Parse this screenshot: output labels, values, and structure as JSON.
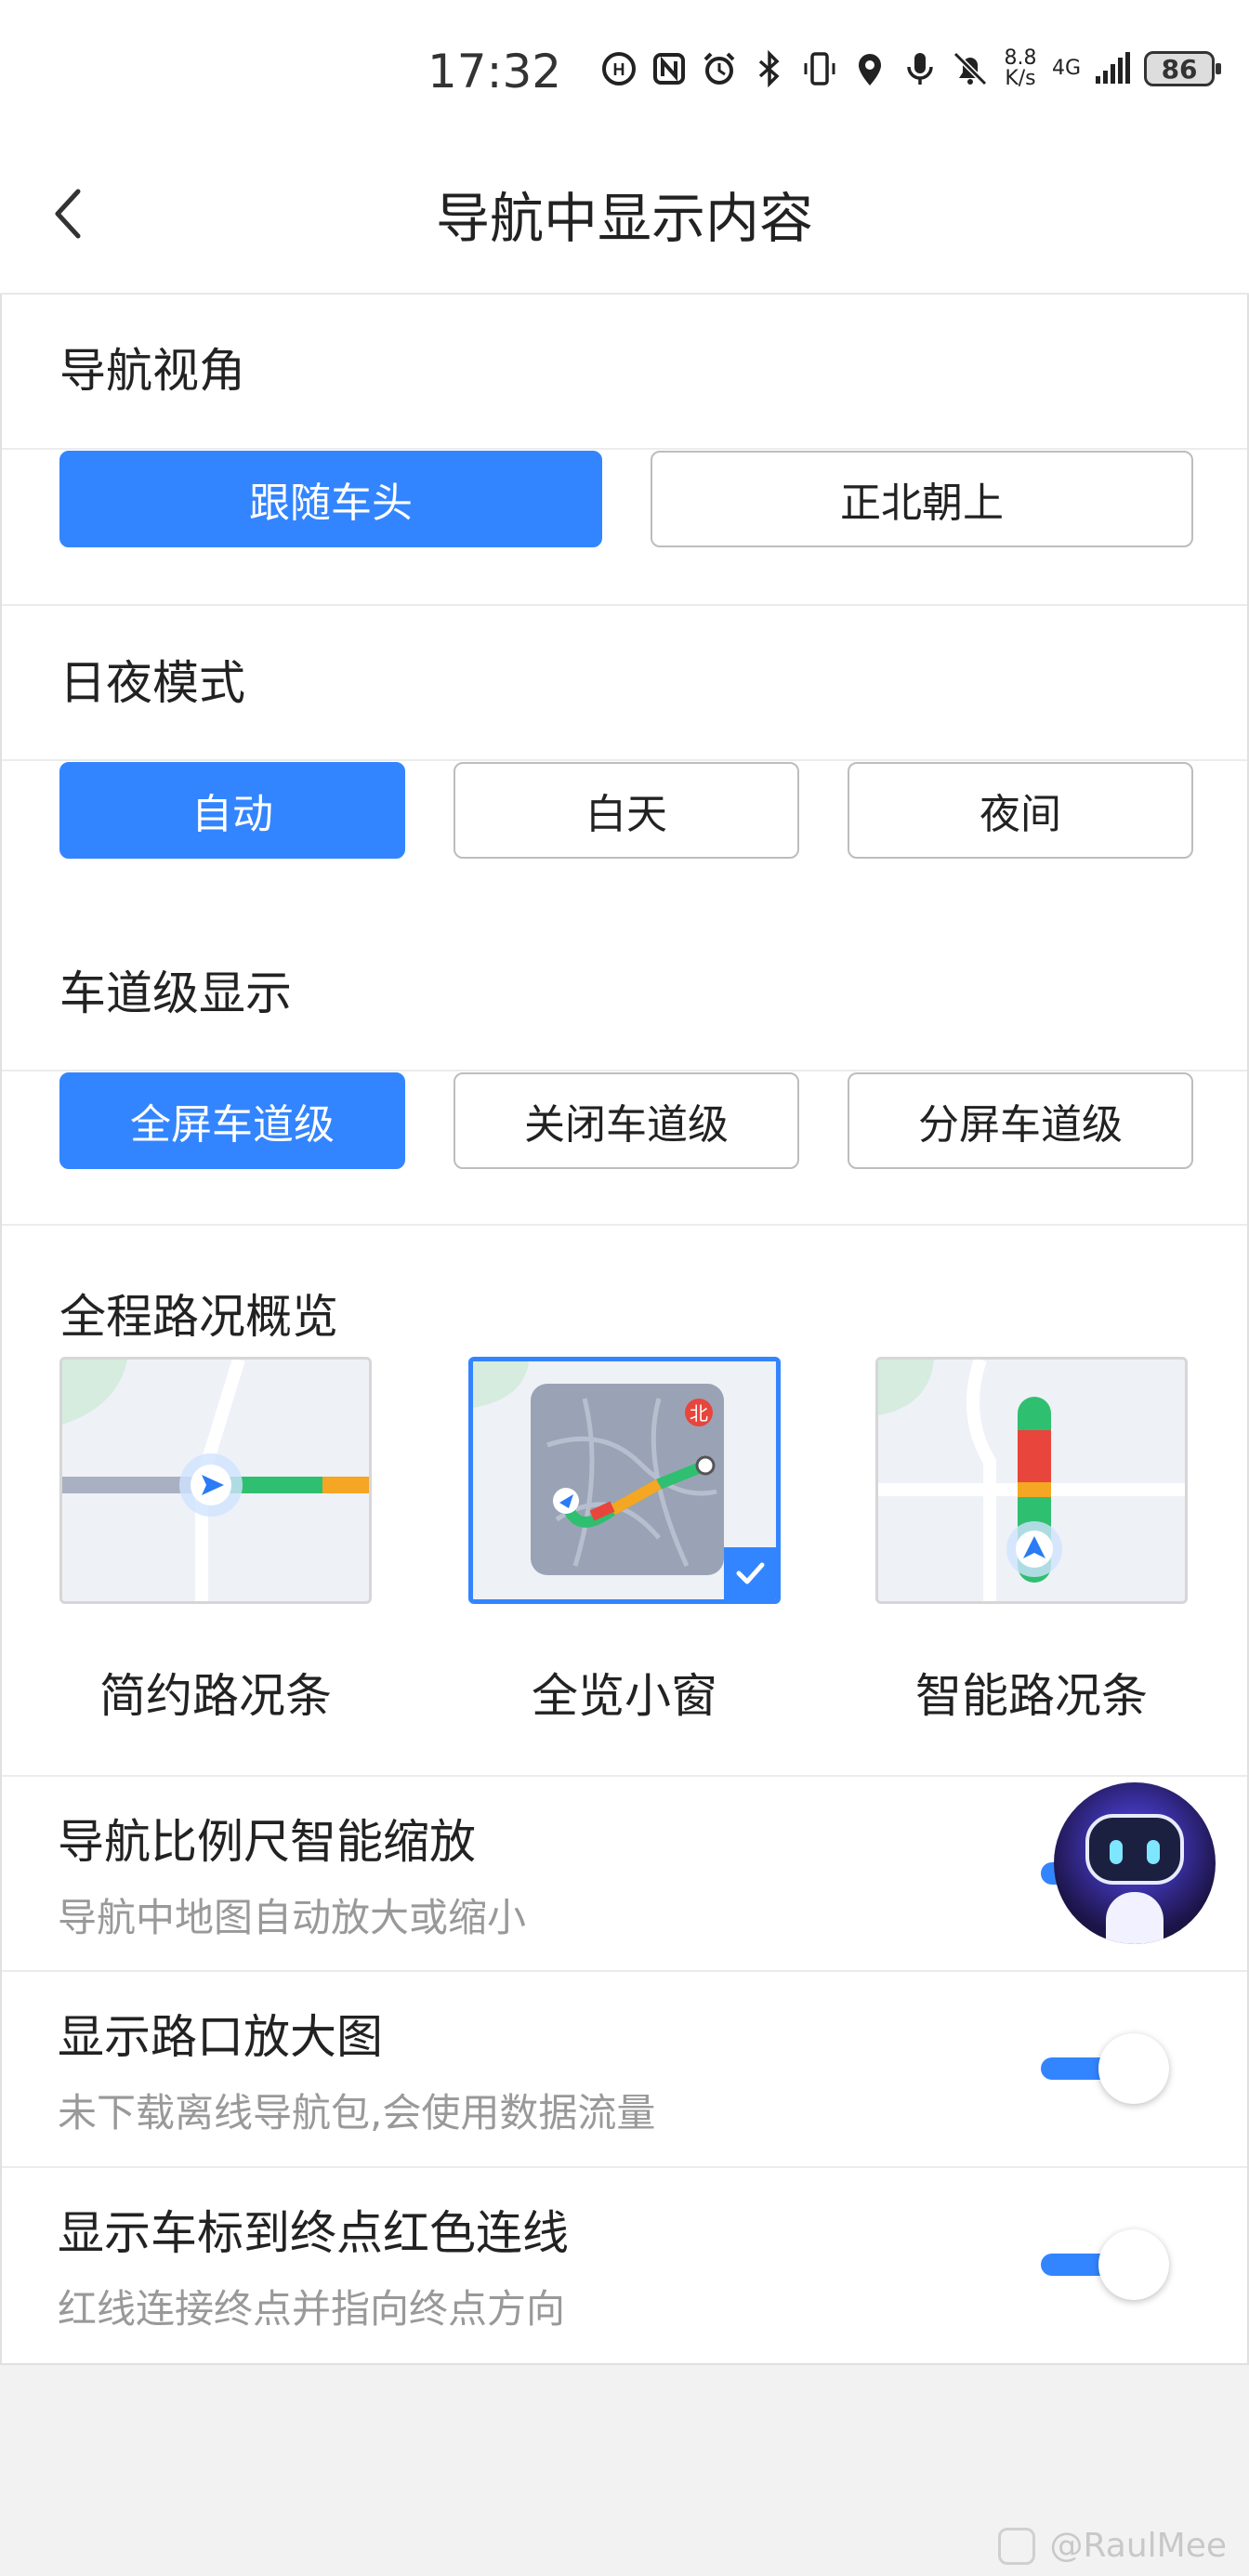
{
  "status_bar": {
    "time": "17:32",
    "net_speed_value": "8.8",
    "net_speed_unit": "K/s",
    "network": "4G",
    "battery": "86",
    "icons": [
      "hd-call-icon",
      "nfc-icon",
      "alarm-icon",
      "bluetooth-icon",
      "vibrate-icon",
      "location-icon",
      "microphone-icon",
      "mute-bell-icon",
      "signal-icon"
    ]
  },
  "header": {
    "title": "导航中显示内容",
    "back_icon": "chevron-left-icon"
  },
  "view_angle": {
    "title": "导航视角",
    "options": [
      "跟随车头",
      "正北朝上"
    ],
    "selected": "跟随车头"
  },
  "day_night": {
    "title": "日夜模式",
    "options": [
      "自动",
      "白天",
      "夜间"
    ],
    "selected": "自动"
  },
  "lane_display": {
    "title": "车道级显示",
    "options": [
      "全屏车道级",
      "关闭车道级",
      "分屏车道级"
    ],
    "selected": "全屏车道级"
  },
  "overview": {
    "title": "全程路况概览",
    "options": [
      "简约路况条",
      "全览小窗",
      "智能路况条"
    ],
    "selected": "全览小窗",
    "map_badge": "北"
  },
  "settings": [
    {
      "title": "导航比例尺智能缩放",
      "subtitle": "导航中地图自动放大或缩小",
      "on": true
    },
    {
      "title": "显示路口放大图",
      "subtitle": "未下载离线导航包,会使用数据流量",
      "on": true
    },
    {
      "title": "显示车标到终点红色连线",
      "subtitle": "红线连接终点并指向终点方向",
      "on": true
    }
  ],
  "watermark": "@RaulMee",
  "colors": {
    "accent": "#3385ff",
    "traffic_green": "#2fbf71",
    "traffic_yellow": "#f5a623",
    "traffic_red": "#e8453c"
  }
}
